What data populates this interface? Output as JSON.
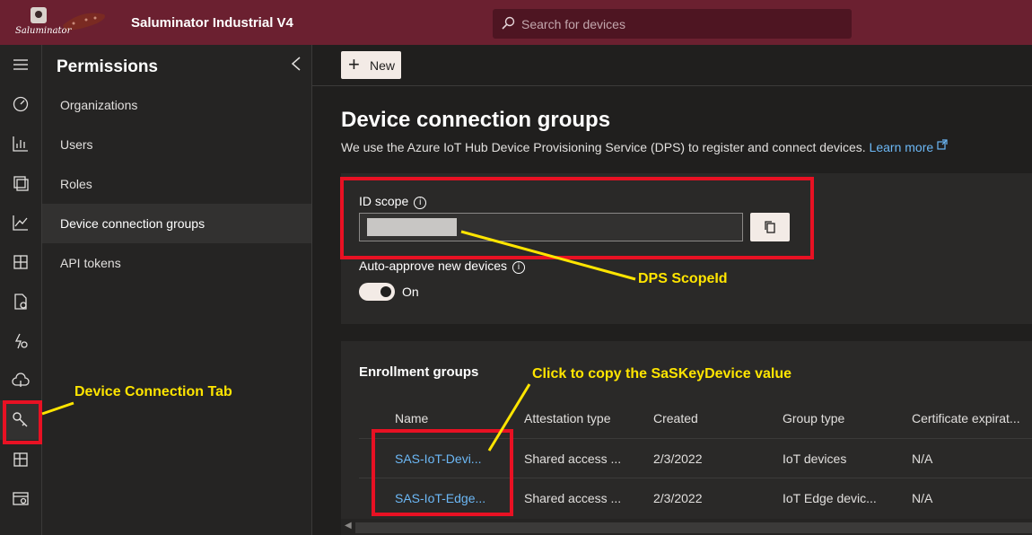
{
  "app": {
    "title": "Saluminator Industrial V4",
    "logo_text": "Saluminator",
    "search_placeholder": "Search for devices"
  },
  "rail": {
    "icons": [
      "menu-icon",
      "dashboard-icon",
      "analytics-icon",
      "devices-icon",
      "chart-icon",
      "templates-icon",
      "jobs-icon",
      "rules-icon",
      "data-export-icon",
      "permissions-key-icon",
      "apps-icon",
      "admin-icon"
    ],
    "active": "permissions-key-icon"
  },
  "nav": {
    "title": "Permissions",
    "items": [
      {
        "label": "Organizations"
      },
      {
        "label": "Users"
      },
      {
        "label": "Roles"
      },
      {
        "label": "Device connection groups",
        "active": true
      },
      {
        "label": "API tokens"
      }
    ]
  },
  "toolbar": {
    "new_label": "New"
  },
  "page": {
    "title": "Device connection groups",
    "subtitle": "We use the Azure IoT Hub Device Provisioning Service (DPS) to register and connect devices.",
    "learn_more": "Learn more"
  },
  "id_scope": {
    "label": "ID scope",
    "value_redacted": true
  },
  "auto_approve": {
    "label": "Auto-approve new devices",
    "state": "On"
  },
  "enrollment": {
    "title": "Enrollment groups",
    "columns": [
      "Name",
      "Attestation type",
      "Created",
      "Group type",
      "Certificate expirat..."
    ],
    "rows": [
      [
        "SAS-IoT-Devi...",
        "Shared access ...",
        "2/3/2022",
        "IoT devices",
        "N/A"
      ],
      [
        "SAS-IoT-Edge...",
        "Shared access ...",
        "2/3/2022",
        "IoT Edge devic...",
        "N/A"
      ]
    ]
  },
  "annotations": {
    "device_tab": "Device Connection Tab",
    "dps_scope": "DPS ScopeId",
    "copy_hint": "Click to copy the SaSKeyDevice value"
  },
  "colors": {
    "topbar": "#6b2030",
    "accent_link": "#6cb8f6",
    "annotation_red": "#e81123",
    "annotation_yellow": "#ffe500"
  }
}
